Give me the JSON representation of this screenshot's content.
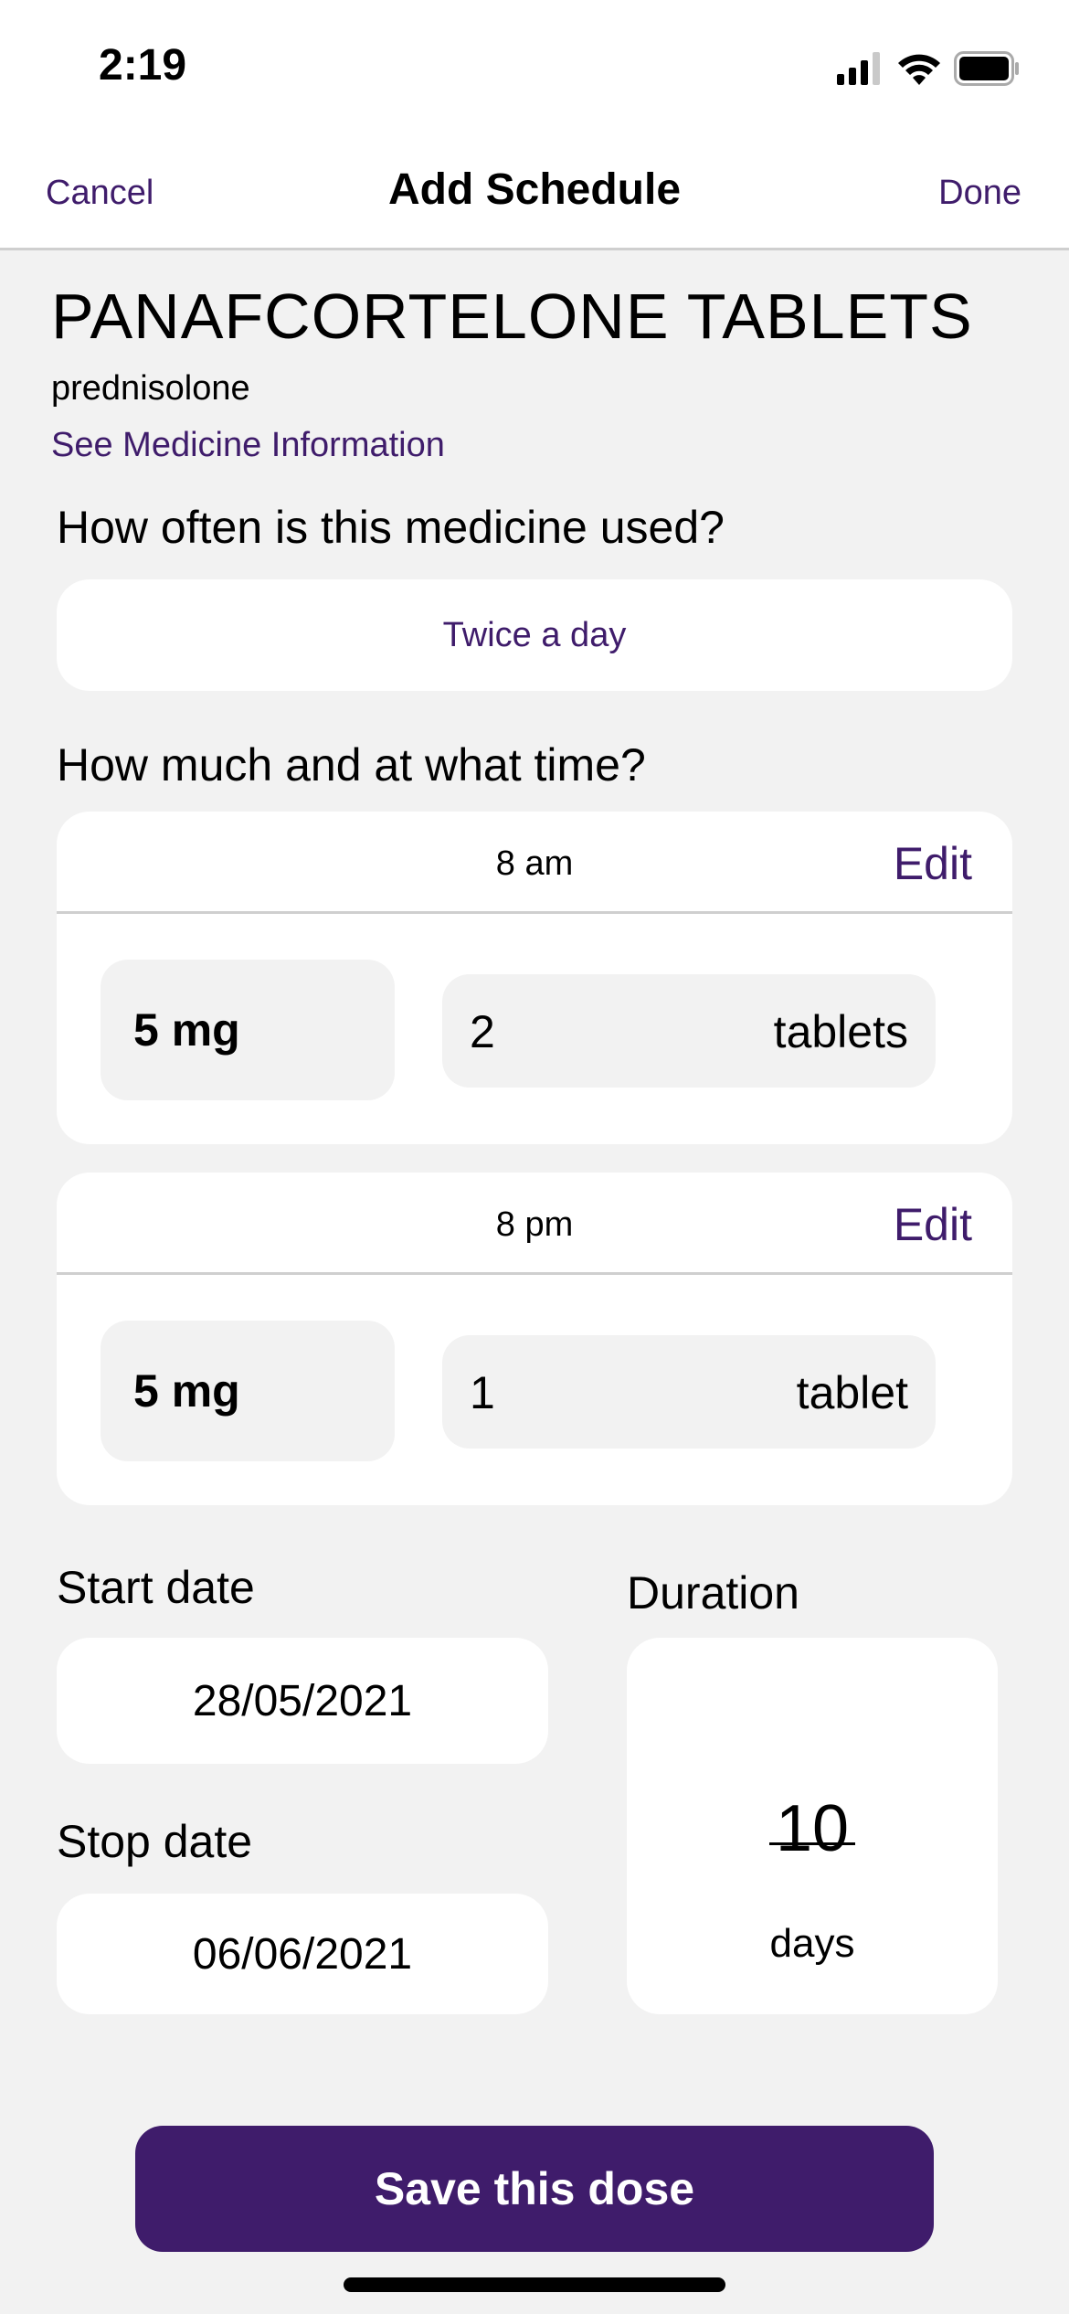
{
  "status_bar": {
    "time": "2:19",
    "icons": [
      "cellular-signal-icon",
      "wifi-icon",
      "battery-icon"
    ]
  },
  "nav": {
    "cancel_label": "Cancel",
    "title": "Add Schedule",
    "done_label": "Done"
  },
  "medicine": {
    "name": "PANAFCORTELONE TABLETS",
    "generic": "prednisolone",
    "info_link": "See Medicine Information"
  },
  "frequency": {
    "question": "How often is this medicine used?",
    "value": "Twice a day"
  },
  "doses": {
    "question": "How much and at what time?",
    "items": [
      {
        "time": "8 am",
        "edit_label": "Edit",
        "strength": "5 mg",
        "quantity": "2",
        "unit": "tablets"
      },
      {
        "time": "8 pm",
        "edit_label": "Edit",
        "strength": "5 mg",
        "quantity": "1",
        "unit": "tablet"
      }
    ]
  },
  "dates": {
    "start_label": "Start date",
    "start_value": "28/05/2021",
    "stop_label": "Stop date",
    "stop_value": "06/06/2021",
    "duration_label": "Duration",
    "duration_value": "10",
    "duration_unit": "days"
  },
  "save_label": "Save this dose",
  "colors": {
    "accent": "#3f1c6b",
    "background": "#f2f2f2",
    "card": "#ffffff",
    "divider": "#cfcfcf"
  }
}
